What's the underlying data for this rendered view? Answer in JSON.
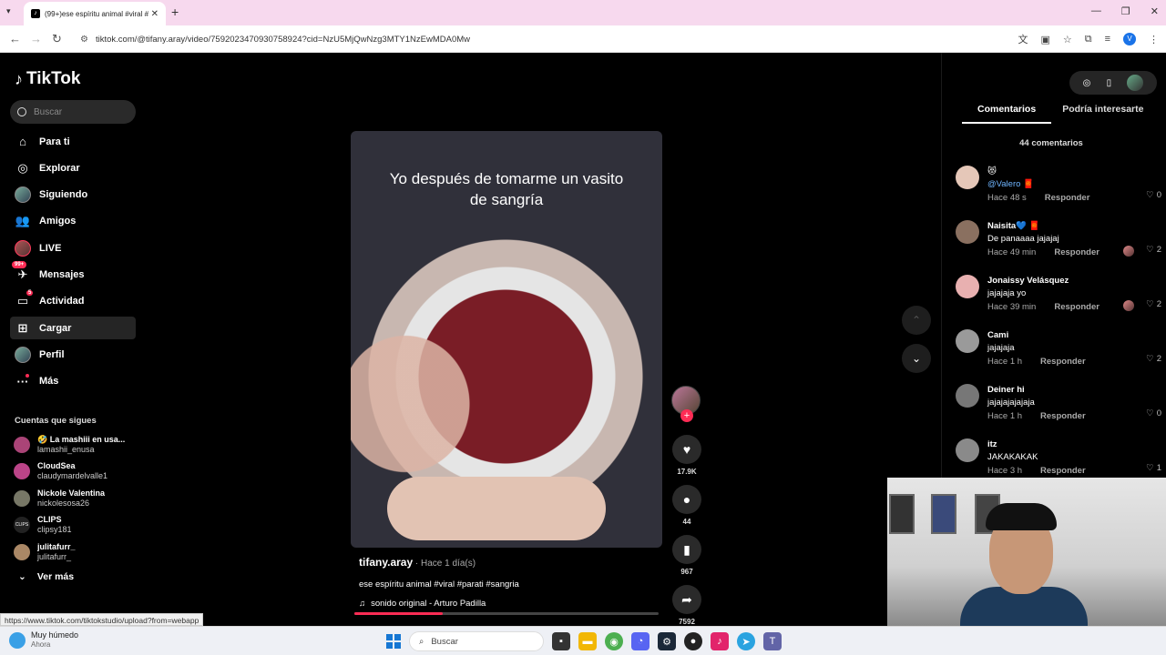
{
  "browser": {
    "tab_title": "(99+)ese espíritu animal #viral #",
    "url": "tiktok.com/@tifany.aray/video/7592023470930758924?cid=NzU5MjQwNzg3MTY1NzEwMDA0Mw",
    "profile_initial": "V"
  },
  "sidebar": {
    "logo": "TikTok",
    "search_placeholder": "Buscar",
    "items": [
      {
        "label": "Para ti"
      },
      {
        "label": "Explorar"
      },
      {
        "label": "Siguiendo"
      },
      {
        "label": "Amigos"
      },
      {
        "label": "LIVE"
      },
      {
        "label": "Mensajes",
        "badge": "99+"
      },
      {
        "label": "Actividad",
        "badge": "5"
      },
      {
        "label": "Cargar"
      },
      {
        "label": "Perfil"
      },
      {
        "label": "Más"
      }
    ],
    "following_title": "Cuentas que sigues",
    "following": [
      {
        "name": "🤣 La mashiii en usa...",
        "handle": "lamashii_enusa"
      },
      {
        "name": "CloudSea",
        "handle": "claudymardelvalle1"
      },
      {
        "name": "Nickole Valentina",
        "handle": "nickolesosa26"
      },
      {
        "name": "CLIPS",
        "handle": "clipsy181",
        "avatar_text": "CLIPS"
      },
      {
        "name": "julitafurr_",
        "handle": "julitafurr_"
      }
    ],
    "see_more": "Ver más"
  },
  "video": {
    "caption": "Yo después de tomarme un vasito de sangría",
    "author": "tifany.aray",
    "time": " · Hace 1 día(s)",
    "description": "ese espíritu animal #viral #parati #sangria",
    "music": "sonido original - Arturo Padilla",
    "progress": 0.29
  },
  "actions": {
    "likes": "17.9K",
    "comments": "44",
    "saves": "967",
    "shares": "7592"
  },
  "panel": {
    "tab_comments": "Comentarios",
    "tab_related": "Podría interesarte",
    "comment_count": "44 comentarios",
    "reply_label": "Responder",
    "comments": [
      {
        "name": "😻",
        "text": "@Valero 🧧",
        "time": "Hace 48 s",
        "likes": "0",
        "link": true
      },
      {
        "name": "Naisita💙 🧧",
        "text": "De panaaaa jajajaj",
        "time": "Hace 49 min",
        "likes": "2",
        "creator_liked": true
      },
      {
        "name": "Jonaissy Velásquez",
        "text": "jajajaja yo",
        "time": "Hace 39 min",
        "likes": "2",
        "creator_liked": true
      },
      {
        "name": "Cami",
        "text": "jajajaja",
        "time": "Hace 1 h",
        "likes": "2"
      },
      {
        "name": "Deiner hi",
        "text": "jajajajajajaja",
        "time": "Hace 1 h",
        "likes": "0"
      },
      {
        "name": "itz",
        "text": "JAKAKAKAK",
        "time": "Hace 3 h",
        "likes": "1"
      }
    ]
  },
  "status_url": "https://www.tiktok.com/tiktokstudio/upload?from=webapp",
  "taskbar": {
    "weather_title": "Muy húmedo",
    "weather_sub": "Ahora",
    "search": "Buscar"
  }
}
